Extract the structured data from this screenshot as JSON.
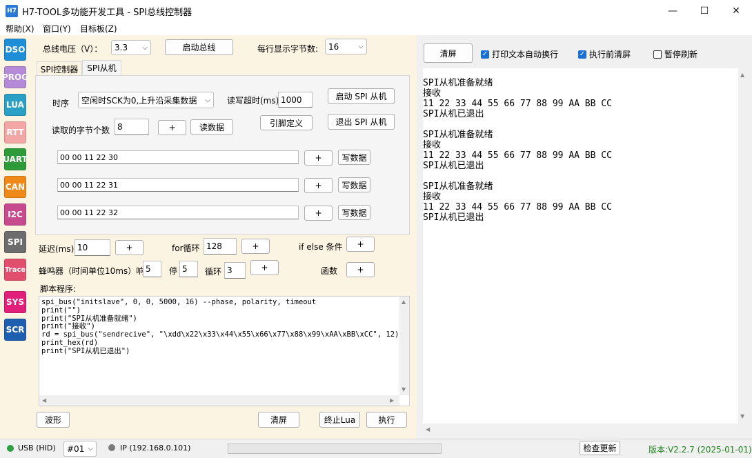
{
  "window": {
    "app_icon": "H7",
    "title": "H7-TOOL多功能开发工具 - SPI总线控制器",
    "minimize": "—",
    "maximize": "☐",
    "close": "✕"
  },
  "menu": [
    "帮助(X)",
    "窗口(Y)",
    "目标板(Z)"
  ],
  "sidebar": [
    {
      "label": "DSO",
      "color": "#1e8fd6"
    },
    {
      "label": "PROG",
      "color": "#b58ad6"
    },
    {
      "label": "LUA",
      "color": "#2aa1c4"
    },
    {
      "label": "RTT",
      "color": "#f2a6a6"
    },
    {
      "label": "UART",
      "color": "#2e9a3a"
    },
    {
      "label": "CAN",
      "color": "#ef8a18"
    },
    {
      "label": "I2C",
      "color": "#c84a8e"
    },
    {
      "label": "SPI",
      "color": "#6d6d6d"
    },
    {
      "label": "Trace",
      "color": "#e0506e"
    },
    {
      "label": "SYS",
      "color": "#e0207a"
    },
    {
      "label": "SCR",
      "color": "#1f5fb0"
    }
  ],
  "bus": {
    "voltage_label": "总线电压（V）：",
    "voltage_value": "3.3",
    "start_bus": "启动总线",
    "bytes_per_line_label": "每行显示字节数:",
    "bytes_per_line_value": "16"
  },
  "tabs": [
    "SPI控制器",
    "SPI从机"
  ],
  "slave": {
    "timing_label": "时序",
    "timing_value": "空闲时SCK为0,上升沿采集数据",
    "timeout_label": "读写超时(ms)",
    "timeout_value": "1000",
    "start_slave": "启动 SPI 从机",
    "read_count_label": "读取的字节个数",
    "read_count_value": "8",
    "plus": "+",
    "read_data": "读数据",
    "pin_define": "引脚定义",
    "exit_slave": "退出 SPI 从机",
    "write_rows": [
      {
        "value": "00 00 11 22 30",
        "button": "写数据"
      },
      {
        "value": "00 00 11 22 31",
        "button": "写数据"
      },
      {
        "value": "00 00 11 22 32",
        "button": "写数据"
      }
    ]
  },
  "helpers": {
    "delay_label": "延迟(ms)",
    "delay_value": "10",
    "for_label": "for循环",
    "for_value": "128",
    "ifelse_label": "if else 条件",
    "buzzer_label": "蜂鸣器（时间单位10ms）响",
    "buzzer_on": "5",
    "stop_label": "停",
    "buzzer_off": "5",
    "loop_label": "循环",
    "buzzer_loop": "3",
    "func_label": "函数",
    "plus": "+"
  },
  "script": {
    "label": "脚本程序:",
    "code": "spi_bus(\"initslave\", 0, 0, 5000, 16) --phase, polarity, timeout\nprint(\"\")\nprint(\"SPI从机准备就绪\")\nprint(\"接收\")\nrd = spi_bus(\"sendrecive\", \"\\xdd\\x22\\x33\\x44\\x55\\x66\\x77\\x88\\x99\\xAA\\xBB\\xCC\", 12)\nprint_hex(rd)\nprint(\"SPI从机已退出\")"
  },
  "bottom_buttons": {
    "waveform": "波形",
    "clear": "清屏",
    "stop_lua": "终止Lua",
    "execute": "执行"
  },
  "right": {
    "clear": "清屏",
    "wrap_label": "打印文本自动换行",
    "clear_before_label": "执行前清屏",
    "pause_label": "暂停刷新",
    "output": "SPI从机准备就绪\n接收\n11 22 33 44 55 66 77 88 99 AA BB CC\nSPI从机已退出\n\nSPI从机准备就绪\n接收\n11 22 33 44 55 66 77 88 99 AA BB CC\nSPI从机已退出\n\nSPI从机准备就绪\n接收\n11 22 33 44 55 66 77 88 99 AA BB CC\nSPI从机已退出"
  },
  "status": {
    "usb": "USB (HID)",
    "usb_color": "#2ea043",
    "port": "#01",
    "ip": "IP (192.168.0.101)",
    "ip_color": "#7a7a7a",
    "check_update": "检查更新",
    "version": "版本:V2.2.7 (2025-01-01)",
    "version_color": "#1a7f1a"
  }
}
